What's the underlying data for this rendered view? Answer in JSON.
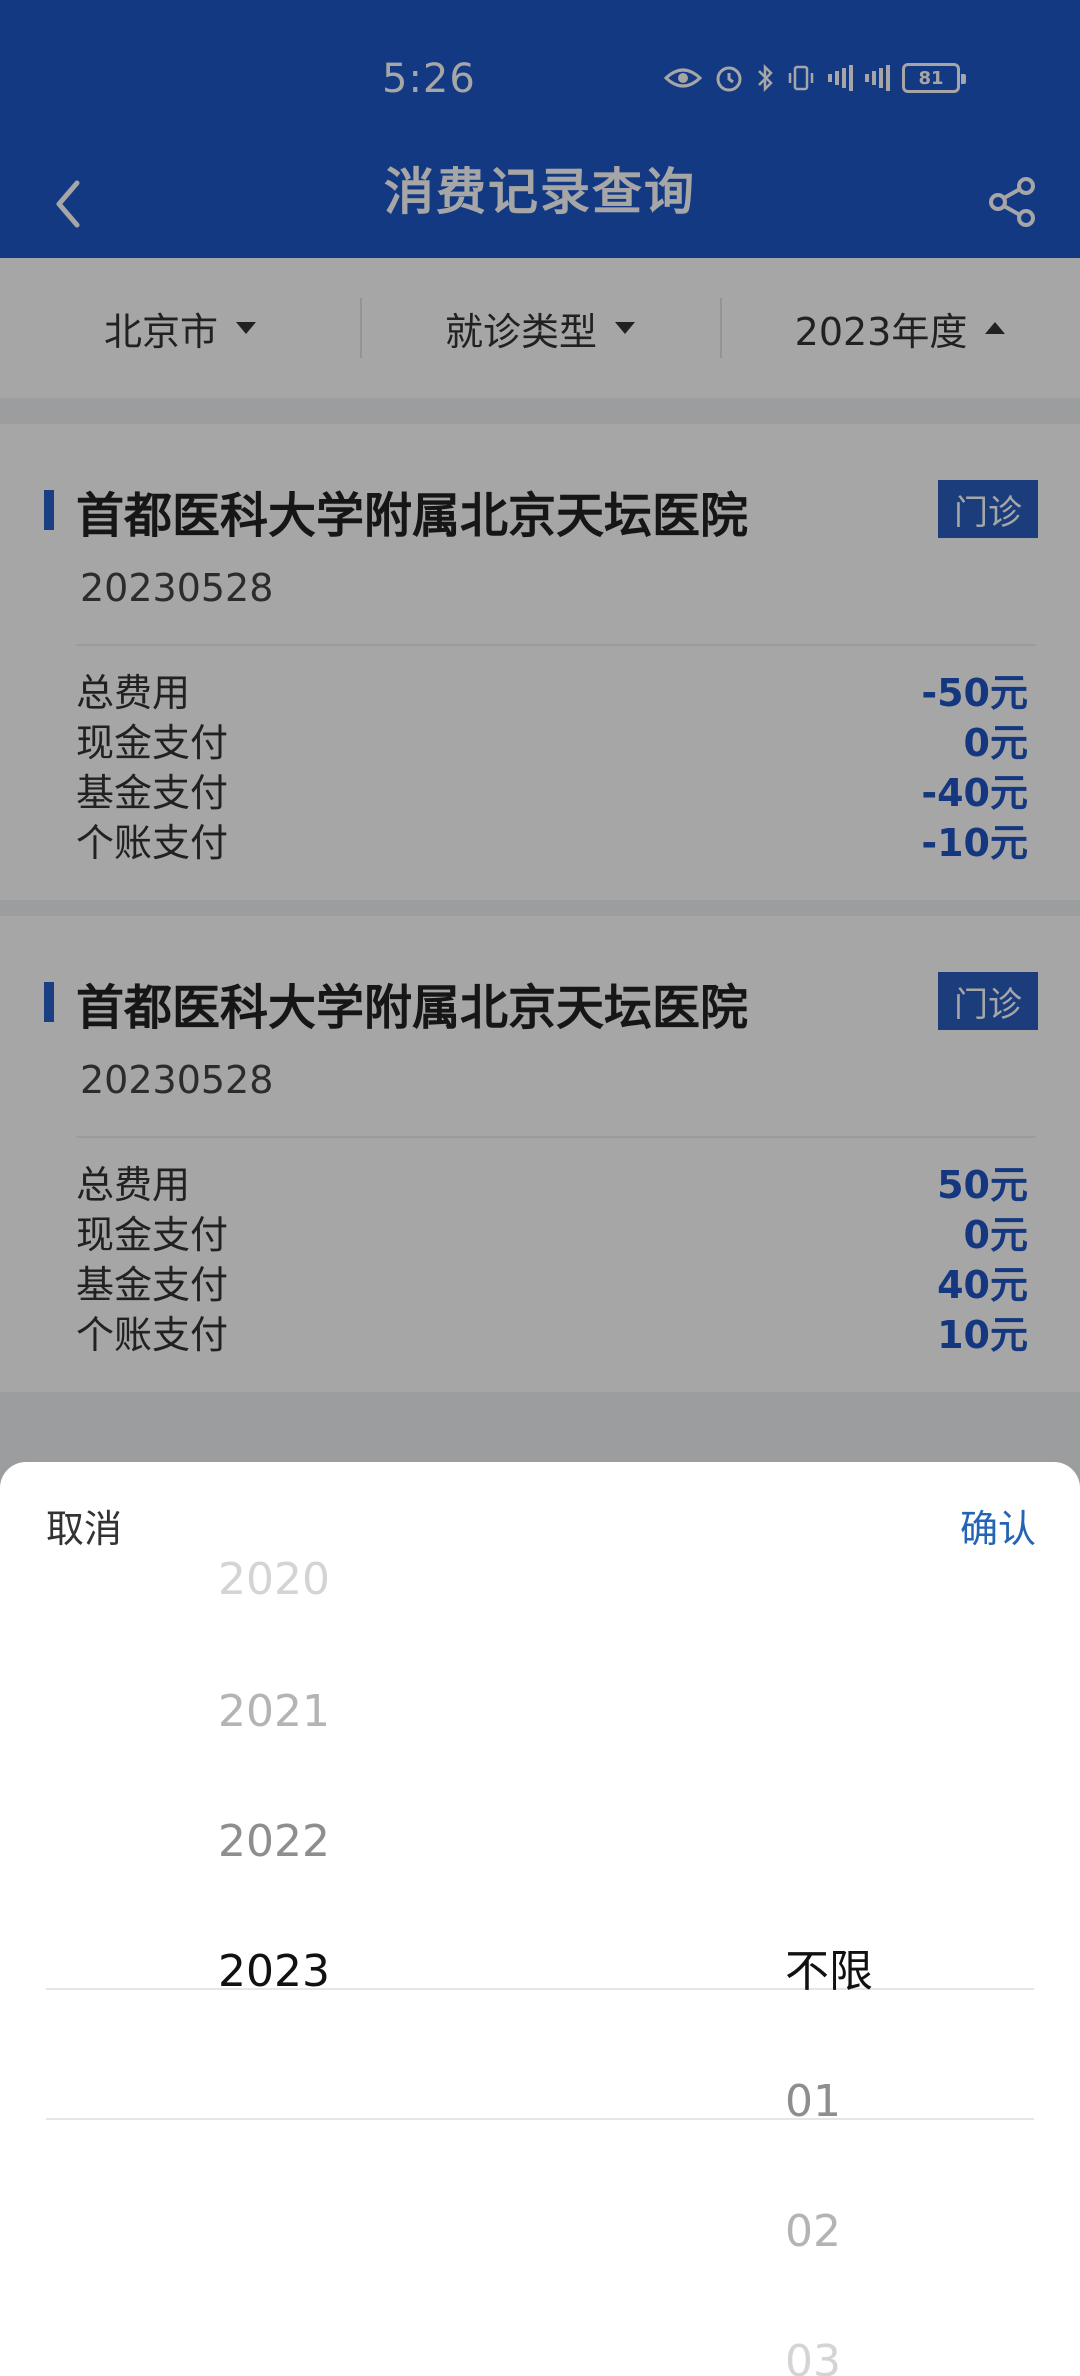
{
  "status_bar": {
    "time": "5:26",
    "battery": "81"
  },
  "nav": {
    "title": "消费记录查询"
  },
  "filters": {
    "city": "北京市",
    "visit_type": "就诊类型",
    "year": "2023年度"
  },
  "records": [
    {
      "hospital": "首都医科大学附属北京天坛医院",
      "badge": "门诊",
      "date": "20230528",
      "rows": [
        {
          "label": "总费用",
          "value": "-50元"
        },
        {
          "label": "现金支付",
          "value": "0元"
        },
        {
          "label": "基金支付",
          "value": "-40元"
        },
        {
          "label": "个账支付",
          "value": "-10元"
        }
      ]
    },
    {
      "hospital": "首都医科大学附属北京天坛医院",
      "badge": "门诊",
      "date": "20230528",
      "rows": [
        {
          "label": "总费用",
          "value": "50元"
        },
        {
          "label": "现金支付",
          "value": "0元"
        },
        {
          "label": "基金支付",
          "value": "40元"
        },
        {
          "label": "个账支付",
          "value": "10元"
        }
      ]
    }
  ],
  "picker": {
    "cancel_label": "取消",
    "confirm_label": "确认",
    "years": [
      "2020",
      "2021",
      "2022",
      "2023"
    ],
    "selected_year": "2023",
    "months": [
      "不限",
      "01",
      "02",
      "03"
    ],
    "selected_month": "不限"
  },
  "colors": {
    "primary": "#1e58c9",
    "value_blue": "#1f55c4",
    "confirm": "#2364b5"
  }
}
